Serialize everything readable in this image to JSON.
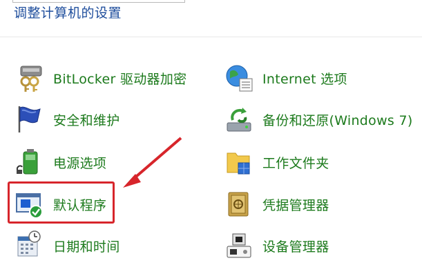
{
  "header": {
    "title": "调整计算机的设置"
  },
  "left_items": [
    {
      "label": "BitLocker 驱动器加密",
      "icon": "bitlocker-key-icon"
    },
    {
      "label": "安全和维护",
      "icon": "security-flag-icon"
    },
    {
      "label": "电源选项",
      "icon": "power-battery-icon"
    },
    {
      "label": "默认程序",
      "icon": "default-programs-icon"
    },
    {
      "label": "日期和时间",
      "icon": "calendar-clock-icon"
    }
  ],
  "right_items": [
    {
      "label": "Internet 选项",
      "icon": "internet-globe-icon"
    },
    {
      "label": "备份和还原(Windows 7)",
      "icon": "backup-restore-icon"
    },
    {
      "label": "工作文件夹",
      "icon": "work-folders-icon"
    },
    {
      "label": "凭据管理器",
      "icon": "credential-safe-icon"
    },
    {
      "label": "设备管理器",
      "icon": "device-manager-icon"
    }
  ],
  "colors": {
    "link": "#1c7a1c",
    "header": "#1e4d9c",
    "highlight": "#d7252b"
  }
}
